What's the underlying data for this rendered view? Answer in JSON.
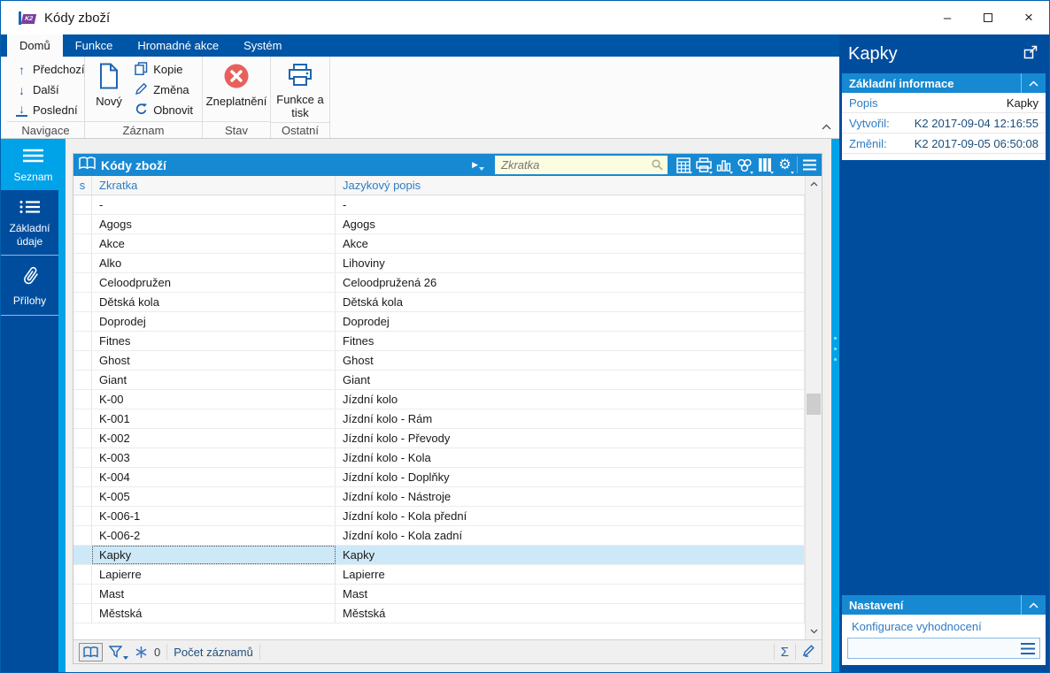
{
  "window": {
    "title": "Kódy zboží",
    "controls": {
      "minimize": "–",
      "close": "×"
    }
  },
  "ribbon": {
    "tabs": [
      {
        "label": "Domů",
        "active": true
      },
      {
        "label": "Funkce",
        "active": false
      },
      {
        "label": "Hromadné akce",
        "active": false
      },
      {
        "label": "Systém",
        "active": false
      }
    ],
    "groups": {
      "navigace": {
        "label": "Navigace",
        "items": [
          {
            "label": "Předchozí",
            "icon": "up-arrow-icon"
          },
          {
            "label": "Další",
            "icon": "down-arrow-icon"
          },
          {
            "label": "Poslední",
            "icon": "down-arrow-underline-icon"
          }
        ]
      },
      "zaznam": {
        "label": "Záznam",
        "primary": {
          "label": "Nový",
          "icon": "new-document-icon"
        },
        "items": [
          {
            "label": "Kopie",
            "icon": "copy-icon"
          },
          {
            "label": "Změna",
            "icon": "pencil-icon"
          },
          {
            "label": "Obnovit",
            "icon": "refresh-icon"
          }
        ]
      },
      "stav": {
        "label": "Stav",
        "primary": {
          "label": "Zneplatnění",
          "icon": "red-x-circle-icon"
        }
      },
      "ostatni": {
        "label": "Ostatní",
        "primary": {
          "label": "Funkce a tisk",
          "icon": "printer-icon"
        }
      }
    }
  },
  "sidebar": {
    "items": [
      {
        "label": "Seznam",
        "icon": "menu-icon",
        "active": true
      },
      {
        "label": "Základní údaje",
        "icon": "list-icon",
        "active": false
      },
      {
        "label": "Přílohy",
        "icon": "paperclip-icon",
        "active": false
      }
    ]
  },
  "table": {
    "title": "Kódy zboží",
    "search": {
      "placeholder": "Zkratka",
      "value": ""
    },
    "toolbar_icons": [
      "calculator-icon",
      "printer-icon",
      "bar-chart-icon",
      "categories-icon",
      "columns-icon",
      "gear-icon",
      "menu-icon"
    ],
    "columns": [
      "s",
      "Zkratka",
      "Jazykový popis"
    ],
    "selected_index": 18,
    "rows": [
      [
        "-",
        "-"
      ],
      [
        "Agogs",
        "Agogs"
      ],
      [
        "Akce",
        "Akce"
      ],
      [
        "Alko",
        "Lihoviny"
      ],
      [
        "Celoodpružen",
        "Celoodpružená 26"
      ],
      [
        "Dětská kola",
        "Dětská kola"
      ],
      [
        "Doprodej",
        "Doprodej"
      ],
      [
        "Fitnes",
        "Fitnes"
      ],
      [
        "Ghost",
        "Ghost"
      ],
      [
        "Giant",
        "Giant"
      ],
      [
        "K-00",
        "Jízdní kolo"
      ],
      [
        "K-001",
        "Jízdní kolo - Rám"
      ],
      [
        "K-002",
        "Jízdní kolo - Převody"
      ],
      [
        "K-003",
        "Jízdní kolo - Kola"
      ],
      [
        "K-004",
        "Jízdní kolo - Doplňky"
      ],
      [
        "K-005",
        "Jízdní kolo - Nástroje"
      ],
      [
        "K-006-1",
        "Jízdní kolo - Kola přední"
      ],
      [
        "K-006-2",
        "Jízdní kolo - Kola zadní"
      ],
      [
        "Kapky",
        "Kapky"
      ],
      [
        "Lapierre",
        "Lapierre"
      ],
      [
        "Mast",
        "Mast"
      ],
      [
        "Městská",
        "Městská"
      ]
    ],
    "status": {
      "special_count": "0",
      "count_label": "Počet záznamů"
    }
  },
  "detail": {
    "title": "Kapky",
    "info": {
      "title": "Základní informace",
      "fields": [
        {
          "label": "Popis",
          "value": "Kapky",
          "style": "plain"
        },
        {
          "label": "Vytvořil:",
          "value": "K2 2017-09-04 12:16:55",
          "style": "link"
        },
        {
          "label": "Změnil:",
          "value": "K2 2017-09-05 06:50:08",
          "style": "link"
        }
      ]
    },
    "settings": {
      "title": "Nastavení",
      "field_label": "Konfigurace vyhodnocení",
      "field_value": ""
    }
  },
  "colors": {
    "tabbar_blue": "#0056A6",
    "cyan_accent": "#00A3E8",
    "panel_header_blue": "#1789D3",
    "dark_panel_blue": "#004D9E",
    "label_blue": "#2E7CC3",
    "invalid_red": "#E8605C",
    "selection_blue": "#CDE9F8",
    "search_bg": "#FCFCE1"
  }
}
